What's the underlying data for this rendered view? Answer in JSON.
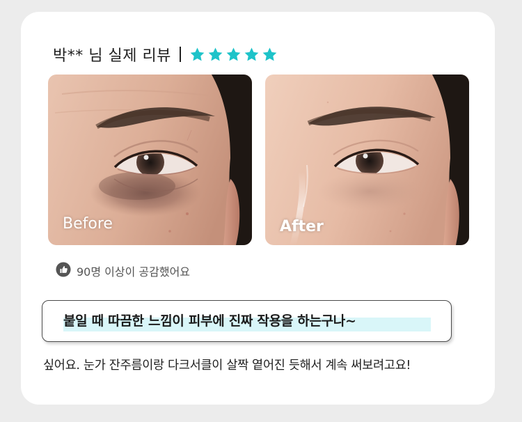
{
  "review": {
    "reviewer_label": "박** 님 실제 리뷰",
    "rating": 5,
    "star_color": "#1ec3c9",
    "photos": {
      "before_label": "Before",
      "after_label": "After"
    },
    "likes_text": "90명 이상이 공감했어요",
    "likes_icon": "thumbs-up-icon",
    "headline": "붙일 때 따끔한 느낌이 피부에 진짜 작용을 하는구나~",
    "headline_highlight_color": "#d9f6f9",
    "body": "싶어요. 눈가 잔주름이랑 다크서클이 살짝 옅어진 듯해서 계속 써보려고요!"
  }
}
